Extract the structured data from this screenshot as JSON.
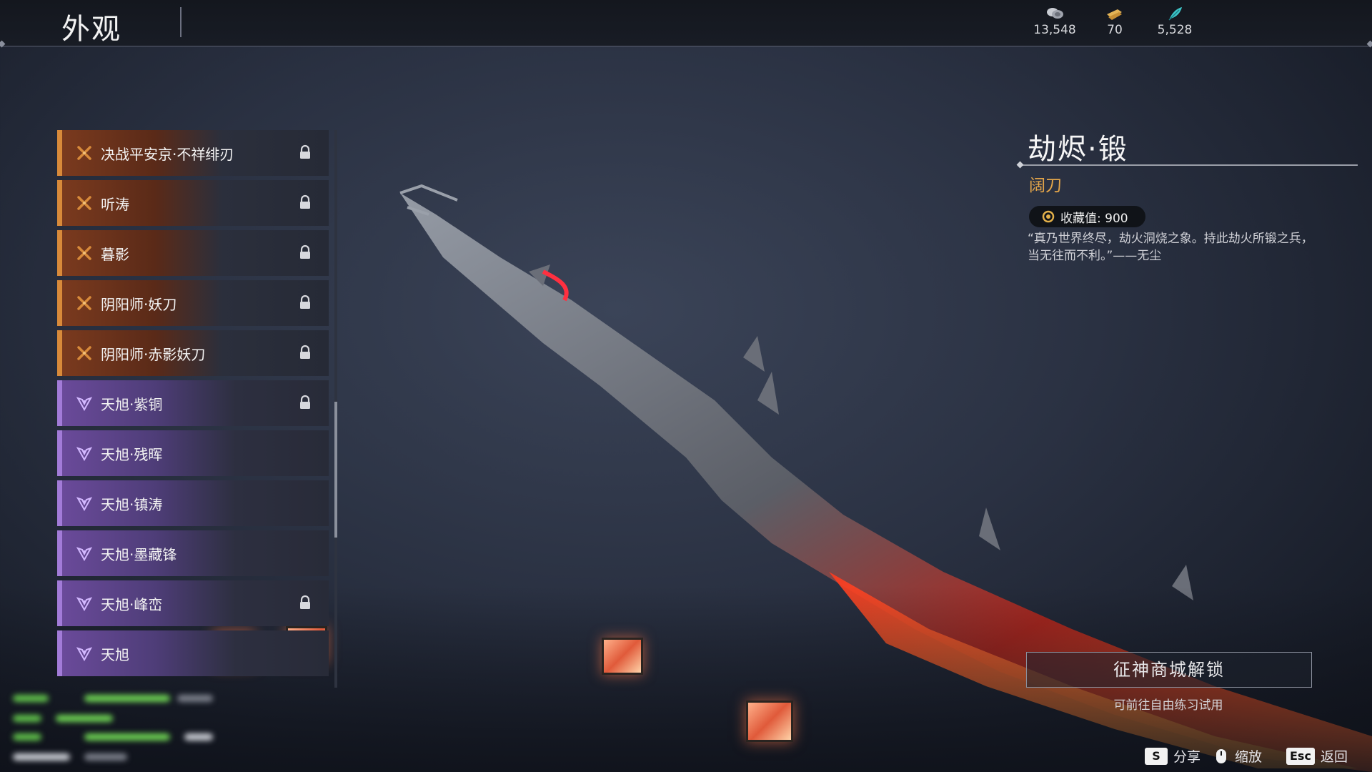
{
  "header": {
    "title": "外观",
    "currencies": [
      {
        "icon": "coin-stack-icon",
        "value": "13,548"
      },
      {
        "icon": "ticket-icon",
        "value": "70"
      },
      {
        "icon": "feather-icon",
        "value": "5,528"
      }
    ]
  },
  "skins": [
    {
      "label": "决战平安京·不祥绯刃",
      "rarity": "gold",
      "locked": true
    },
    {
      "label": "听涛",
      "rarity": "gold",
      "locked": true
    },
    {
      "label": "暮影",
      "rarity": "gold",
      "locked": true
    },
    {
      "label": "阴阳师·妖刀",
      "rarity": "gold",
      "locked": true
    },
    {
      "label": "阴阳师·赤影妖刀",
      "rarity": "gold",
      "locked": true
    },
    {
      "label": "天旭·紫铜",
      "rarity": "purple",
      "locked": true
    },
    {
      "label": "天旭·残晖",
      "rarity": "purple",
      "locked": false
    },
    {
      "label": "天旭·镇涛",
      "rarity": "purple",
      "locked": false
    },
    {
      "label": "天旭·墨藏锋",
      "rarity": "purple",
      "locked": false
    },
    {
      "label": "天旭·峰峦",
      "rarity": "purple",
      "locked": true
    },
    {
      "label": "天旭",
      "rarity": "purple",
      "locked": false
    }
  ],
  "detail": {
    "name": "劫烬·锻",
    "weapon_type": "阔刀",
    "collection_label": "收藏值: 900",
    "quote": "“真乃世界终尽，劫火洞烧之象。持此劫火所锻之兵，当无往而不利。”——无尘",
    "unlock_button": "征神商城解锁",
    "unlock_hint": "可前往自由练习试用"
  },
  "hints": [
    {
      "key": "S",
      "label": "分享"
    },
    {
      "key": "mouse-icon",
      "label": "缩放"
    },
    {
      "key": "Esc",
      "label": "返回"
    }
  ],
  "colors": {
    "gold_accent": "#d88a3a",
    "purple_accent": "#a27bd8",
    "type_text": "#e3a54a"
  }
}
